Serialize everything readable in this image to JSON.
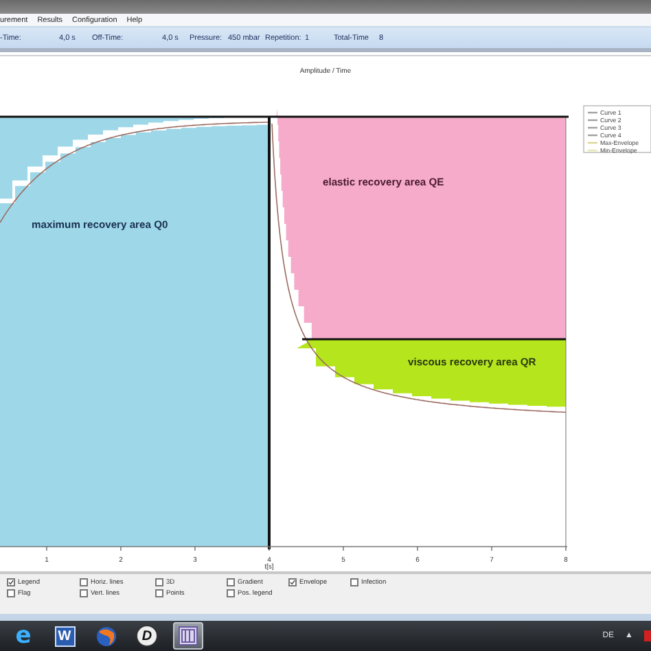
{
  "menu": [
    "urement",
    "Results",
    "Configuration",
    "Help"
  ],
  "info": [
    {
      "label": "-Time:",
      "value": "4,0 s"
    },
    {
      "label": "Off-Time:",
      "value": "4,0 s"
    },
    {
      "label": "Pressure:",
      "value": "450 mbar"
    },
    {
      "label": "Repetition:",
      "value": "1"
    },
    {
      "label": "Total-Time",
      "value": "8"
    }
  ],
  "chart": {
    "title": "Amplitude / Time",
    "x_ticks": [
      "1",
      "2",
      "3",
      "4",
      "5",
      "6",
      "7",
      "8"
    ],
    "x_unit": "t[s]",
    "areas": [
      {
        "label": "maximum recovery area Q0",
        "color": "#9dd7e8"
      },
      {
        "label": "elastic recovery area QE",
        "color": "#f5abc9"
      },
      {
        "label": "viscous recovery area QR",
        "color": "#b5e61d"
      }
    ],
    "legend": [
      {
        "label": "Curve 1",
        "color": "#a0a0a0"
      },
      {
        "label": "Curve 2",
        "color": "#a0a0a0"
      },
      {
        "label": "Curve 3",
        "color": "#a0a0a0"
      },
      {
        "label": "Curve 4",
        "color": "#a0a0a0"
      },
      {
        "label": "Max-Envelope",
        "color": "#d8d890"
      },
      {
        "label": "Min-Envelope",
        "color": "#e8e8b0"
      }
    ]
  },
  "options": [
    [
      {
        "label": "Legend",
        "checked": true
      },
      {
        "label": "Flag",
        "checked": false
      }
    ],
    [
      {
        "label": "Horiz. lines",
        "checked": false
      },
      {
        "label": "Vert. lines",
        "checked": false
      }
    ],
    [
      {
        "label": "3D",
        "checked": false
      },
      {
        "label": "Points",
        "checked": false
      }
    ],
    [
      {
        "label": "Gradient",
        "checked": false
      },
      {
        "label": "Pos. legend",
        "checked": false
      }
    ],
    [
      {
        "label": "Envelope",
        "checked": true
      }
    ],
    [
      {
        "label": "Infection",
        "checked": false
      }
    ]
  ],
  "taskbar": [
    {
      "kind": "letter",
      "glyph": "e",
      "selected": false
    },
    {
      "kind": "tile",
      "glyph": "W",
      "selected": false
    },
    {
      "kind": "globe",
      "selected": false
    },
    {
      "kind": "disc",
      "glyph": "D",
      "selected": false
    },
    {
      "kind": "app",
      "selected": true
    }
  ],
  "tray": {
    "language": "DE",
    "arrow": "▲"
  }
}
